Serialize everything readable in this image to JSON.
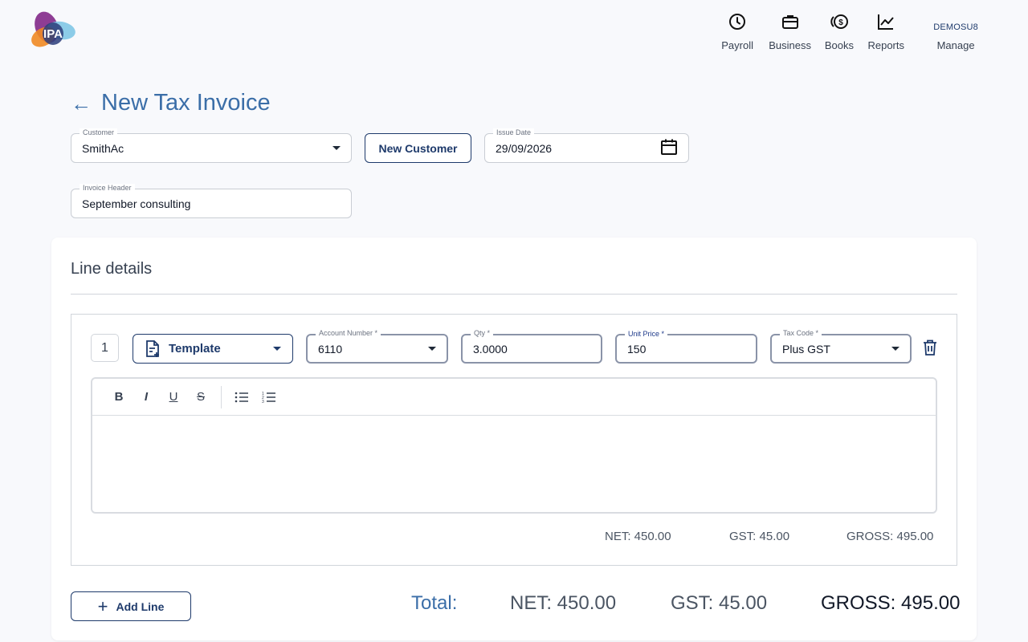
{
  "header": {
    "logo_text": "IPA",
    "nav": [
      {
        "label": "Payroll",
        "icon": "clock-icon"
      },
      {
        "label": "Business",
        "icon": "briefcase-icon"
      },
      {
        "label": "Books",
        "icon": "coins-icon"
      },
      {
        "label": "Reports",
        "icon": "chart-line-icon"
      }
    ],
    "user": {
      "name": "DEMOSU8",
      "label": "Manage"
    }
  },
  "page": {
    "back_icon": "arrow-left-icon",
    "title": "New Tax Invoice"
  },
  "form": {
    "customer": {
      "label": "Customer",
      "value": "SmithAc"
    },
    "new_customer_label": "New Customer",
    "issue_date": {
      "label": "Issue Date",
      "value": "29/09/2026"
    },
    "invoice_header": {
      "label": "Invoice Header",
      "value": "September consulting"
    }
  },
  "line_details": {
    "title": "Line details",
    "lines": [
      {
        "number": "1",
        "template_label": "Template",
        "account_number": {
          "label": "Account Number *",
          "value": "6110"
        },
        "qty": {
          "label": "Qty *",
          "value": "3.0000"
        },
        "unit_price": {
          "label": "Unit Price *",
          "value": "150"
        },
        "tax_code": {
          "label": "Tax Code *",
          "value": "Plus GST"
        },
        "description": "",
        "net": "NET: 450.00",
        "gst": "GST: 45.00",
        "gross": "GROSS: 495.00"
      }
    ],
    "toolbar": [
      "B",
      "I",
      "U",
      "S"
    ],
    "add_line_label": "Add Line",
    "totals": {
      "label": "Total:",
      "net": "NET: 450.00",
      "gst": "GST: 45.00",
      "gross": "GROSS: 495.00"
    }
  },
  "colors": {
    "primary": "#1e3a6b",
    "title_blue": "#3b6ea8",
    "background": "#f8f9fc"
  }
}
